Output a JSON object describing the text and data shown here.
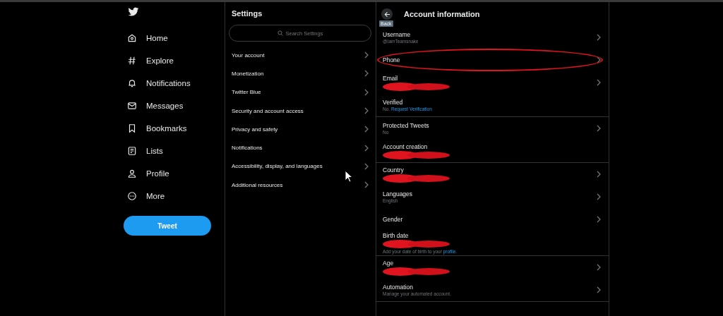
{
  "nav": {
    "items": [
      {
        "label": "Home",
        "kind": "home"
      },
      {
        "label": "Explore",
        "kind": "hash"
      },
      {
        "label": "Notifications",
        "kind": "bell"
      },
      {
        "label": "Messages",
        "kind": "mail"
      },
      {
        "label": "Bookmarks",
        "kind": "bookmark"
      },
      {
        "label": "Lists",
        "kind": "list"
      },
      {
        "label": "Profile",
        "kind": "person"
      },
      {
        "label": "More",
        "kind": "more"
      }
    ],
    "tweet_button": "Tweet"
  },
  "settings": {
    "title": "Settings",
    "search": {
      "placeholder": "Search Settings"
    },
    "items": [
      "Your account",
      "Monetization",
      "Twitter Blue",
      "Security and account access",
      "Privacy and safety",
      "Notifications",
      "Accessibility, display, and languages",
      "Additional resources"
    ]
  },
  "account": {
    "title": "Account information",
    "back_tooltip": "Back",
    "sections": [
      {
        "rows": [
          {
            "label": "Username",
            "sub": "@IamTeamsnake",
            "chevron": true,
            "redacted": false,
            "highlighted": false
          },
          {
            "label": "Phone",
            "chevron": true,
            "redacted": false,
            "highlighted": true
          },
          {
            "label": "Email",
            "chevron": true,
            "redacted": true,
            "highlighted": false
          },
          {
            "label": "Verified",
            "sub": "No.",
            "sub_link": "Request Verification",
            "chevron": false,
            "redacted": false,
            "highlighted": false
          }
        ]
      },
      {
        "rows": [
          {
            "label": "Protected Tweets",
            "sub": "No",
            "chevron": true,
            "redacted": false,
            "highlighted": false
          },
          {
            "label": "Account creation",
            "chevron": false,
            "redacted": true,
            "highlighted": false
          }
        ]
      },
      {
        "rows": [
          {
            "label": "Country",
            "chevron": true,
            "redacted": true,
            "highlighted": false
          },
          {
            "label": "Languages",
            "sub": "English",
            "chevron": true,
            "redacted": false,
            "highlighted": false
          },
          {
            "label": "Gender",
            "chevron": true,
            "redacted": false,
            "highlighted": false
          },
          {
            "label": "Birth date",
            "chevron": false,
            "redacted": true,
            "highlighted": false,
            "note": "Add your date of birth to your",
            "note_link": "profile",
            "note_end": "."
          }
        ]
      },
      {
        "rows": [
          {
            "label": "Age",
            "chevron": true,
            "redacted": true,
            "highlighted": false
          },
          {
            "label": "Automation",
            "sub": "Manage your automated account.",
            "chevron": true,
            "redacted": false,
            "highlighted": false
          }
        ]
      }
    ]
  }
}
